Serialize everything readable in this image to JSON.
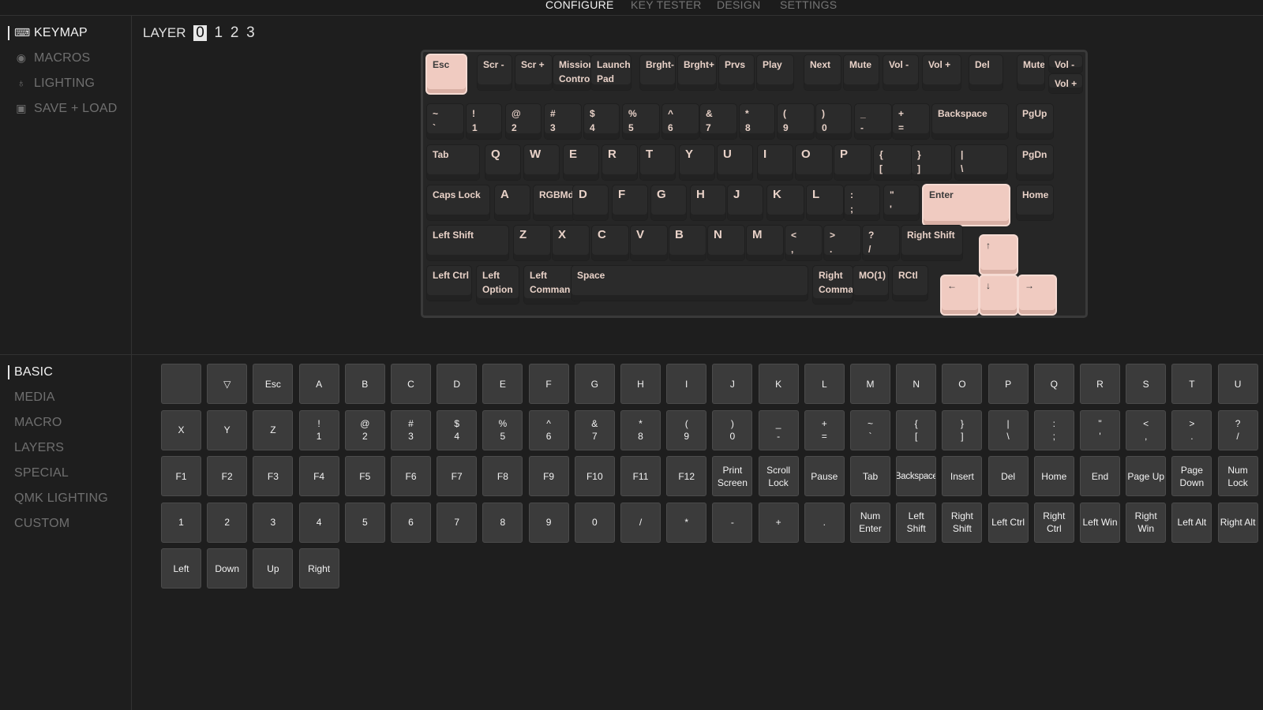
{
  "top_nav": {
    "configure": "CONFIGURE",
    "key_tester": "KEY TESTER",
    "design": "DESIGN",
    "settings": "SETTINGS"
  },
  "sidebar": {
    "items": [
      {
        "label": "KEYMAP",
        "icon": "keyboard-icon"
      },
      {
        "label": "MACROS",
        "icon": "record-icon"
      },
      {
        "label": "LIGHTING",
        "icon": "bulb-icon"
      },
      {
        "label": "SAVE + LOAD",
        "icon": "floppy-disk-icon"
      }
    ]
  },
  "layer": {
    "label": "LAYER",
    "options": [
      "0",
      "1",
      "2",
      "3"
    ],
    "selected": "0"
  },
  "keyboard": {
    "keys": [
      [
        "Esc"
      ],
      [
        "Scr -"
      ],
      [
        "Scr +"
      ],
      [
        "Mission",
        "Control"
      ],
      [
        "Launch",
        "Pad"
      ],
      [
        "Brght-"
      ],
      [
        "Brght+"
      ],
      [
        "Prvs"
      ],
      [
        "Play"
      ],
      [
        "Next"
      ],
      [
        "Mute"
      ],
      [
        "Vol -"
      ],
      [
        "Vol +"
      ],
      [
        "Del"
      ],
      [
        "Mute"
      ],
      [
        "Vol -"
      ],
      [
        "Vol +"
      ],
      [
        "~",
        "`"
      ],
      [
        "!",
        "1"
      ],
      [
        "@",
        "2"
      ],
      [
        "#",
        "3"
      ],
      [
        "$",
        "4"
      ],
      [
        "%",
        "5"
      ],
      [
        "^",
        "6"
      ],
      [
        "&",
        "7"
      ],
      [
        "*",
        "8"
      ],
      [
        "(",
        "9"
      ],
      [
        ")",
        "0"
      ],
      [
        "_",
        "-"
      ],
      [
        "+",
        "="
      ],
      [
        "Backspace"
      ],
      [
        "PgUp"
      ],
      [
        "Tab"
      ],
      [
        "Q"
      ],
      [
        "W"
      ],
      [
        "E"
      ],
      [
        "R"
      ],
      [
        "T"
      ],
      [
        "Y"
      ],
      [
        "U"
      ],
      [
        "I"
      ],
      [
        "O"
      ],
      [
        "P"
      ],
      [
        "{",
        "["
      ],
      [
        "}",
        "]"
      ],
      [
        "|",
        "\\"
      ],
      [
        "PgDn"
      ],
      [
        "Caps Lock"
      ],
      [
        "A"
      ],
      [
        "RGBMdl"
      ],
      [
        "D"
      ],
      [
        "F"
      ],
      [
        "G"
      ],
      [
        "H"
      ],
      [
        "J"
      ],
      [
        "K"
      ],
      [
        "L"
      ],
      [
        ":",
        ";"
      ],
      [
        "\"",
        "'"
      ],
      [
        "Enter"
      ],
      [
        "Home"
      ],
      [
        "Left Shift"
      ],
      [
        "Z"
      ],
      [
        "X"
      ],
      [
        "C"
      ],
      [
        "V"
      ],
      [
        "B"
      ],
      [
        "N"
      ],
      [
        "M"
      ],
      [
        "<",
        ","
      ],
      [
        ">",
        "."
      ],
      [
        "?",
        "/"
      ],
      [
        "Right Shift"
      ],
      [
        "↑"
      ],
      [
        "Left Ctrl"
      ],
      [
        "Left",
        "Option"
      ],
      [
        "Left",
        "Command"
      ],
      [
        "Space"
      ],
      [
        "Right",
        "Comma"
      ],
      [
        "MO(1)"
      ],
      [
        "RCtl"
      ],
      [
        "←"
      ],
      [
        "↓"
      ],
      [
        "→"
      ]
    ]
  },
  "picker": {
    "categories": [
      "BASIC",
      "MEDIA",
      "MACRO",
      "LAYERS",
      "SPECIAL",
      "QMK LIGHTING",
      "CUSTOM"
    ],
    "active": "BASIC",
    "rows": [
      [
        "",
        "▽",
        "Esc",
        "A",
        "B",
        "C",
        "D",
        "E",
        "F",
        "G",
        "H",
        "I",
        "J",
        "K",
        "L",
        "M",
        "N",
        "O",
        "P",
        "Q",
        "R",
        "S",
        "T",
        "U"
      ],
      [
        "X",
        "Y",
        "Z",
        "!\n1",
        "@\n2",
        "#\n3",
        "$\n4",
        "%\n5",
        "^\n6",
        "&\n7",
        "*\n8",
        "(\n9",
        ")\n0",
        "_\n-",
        "+\n=",
        "~\n`",
        "{\n[",
        "}\n]",
        "|\n\\",
        ":\n;",
        "\"\n'",
        "<\n,",
        ">\n.",
        "?\n/"
      ],
      [
        "F1",
        "F2",
        "F3",
        "F4",
        "F5",
        "F6",
        "F7",
        "F8",
        "F9",
        "F10",
        "F11",
        "F12",
        "Print\nScreen",
        "Scroll\nLock",
        "Pause",
        "Tab",
        "Backspace",
        "Insert",
        "Del",
        "Home",
        "End",
        "Page Up",
        "Page\nDown",
        "Num\nLock"
      ],
      [
        "1",
        "2",
        "3",
        "4",
        "5",
        "6",
        "7",
        "8",
        "9",
        "0",
        "/",
        "*",
        "-",
        "+",
        ".",
        "Num\nEnter",
        "Left\nShift",
        "Right\nShift",
        "Left Ctrl",
        "Right\nCtrl",
        "Left Win",
        "Right\nWin",
        "Left Alt",
        "Right Alt"
      ],
      [
        "Left",
        "Down",
        "Up",
        "Right"
      ]
    ]
  }
}
